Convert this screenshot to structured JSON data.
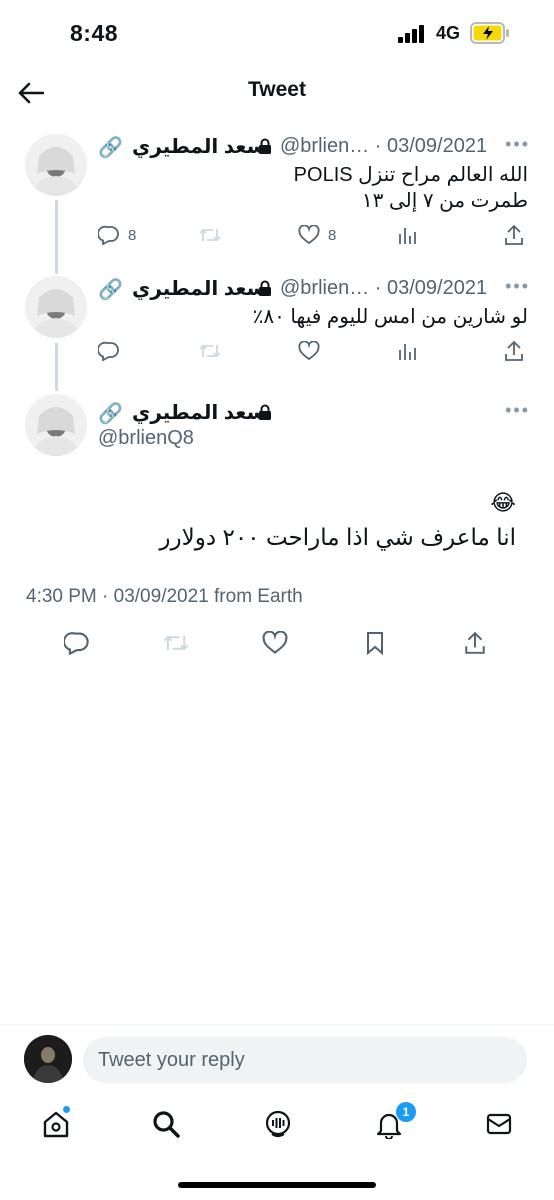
{
  "status": {
    "time": "8:48",
    "network": "4G"
  },
  "nav": {
    "title": "Tweet"
  },
  "thread": [
    {
      "name": "سعد المطيري",
      "handle_date": "@brlien… · 03/09/2021",
      "text_line1": "الله العالم مراح تنزل POLIS",
      "text_line2": "طمرت من ٧ إلى ١٣",
      "replies": "8",
      "likes": "8"
    },
    {
      "name": "سعد المطيري",
      "handle_date": "@brlien… · 03/09/2021",
      "text_line1": "لو شارين من امس لليوم فيها ٨٠٪",
      "replies": "",
      "likes": ""
    }
  ],
  "focus": {
    "name": "سعد المطيري",
    "handle": "@brlienQ8",
    "emoji": "😂",
    "text": "انا ماعرف شي اذا ماراحت ٢٠٠ دولارر",
    "meta": "4:30 PM · 03/09/2021 from Earth"
  },
  "reply": {
    "placeholder": "Tweet your reply"
  },
  "tabs": {
    "notification_count": "1"
  },
  "icons": {
    "link": "link-icon",
    "lock": "lock-icon",
    "reply": "reply-icon",
    "retweet": "retweet-icon",
    "like": "heart-icon",
    "views": "views-icon",
    "share": "share-icon",
    "bookmark": "bookmark-icon"
  },
  "colors": {
    "accent": "#1d9bf0",
    "secondary_text": "#536471",
    "battery": "#f5d90a"
  }
}
